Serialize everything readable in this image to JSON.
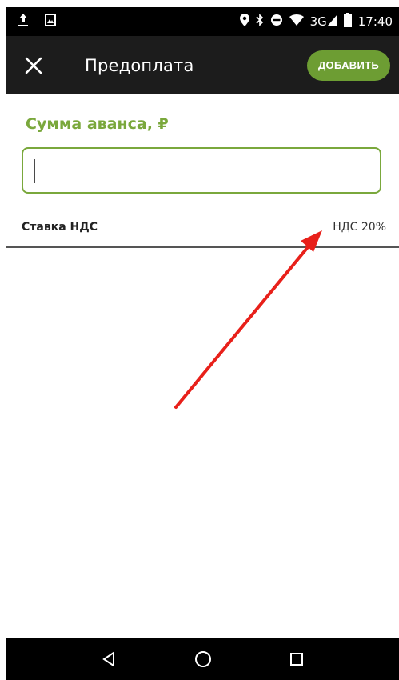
{
  "status_bar": {
    "network": "3G",
    "time": "17:40"
  },
  "app_bar": {
    "title": "Предоплата",
    "add_label": "ДОБАВИТЬ"
  },
  "form": {
    "amount_label": "Сумма аванса, ₽",
    "amount_value": "",
    "vat_label": "Ставка НДС",
    "vat_value": "НДС 20%"
  },
  "colors": {
    "accent": "#7aa83c",
    "button": "#6d9d33",
    "annotation_arrow": "#e8201a"
  },
  "icons": [
    "upload-icon",
    "image-icon",
    "location-icon",
    "bluetooth-icon",
    "do-not-disturb-icon",
    "wifi-icon",
    "signal-icon",
    "battery-icon",
    "close-icon",
    "back-icon",
    "home-icon",
    "recents-icon"
  ]
}
